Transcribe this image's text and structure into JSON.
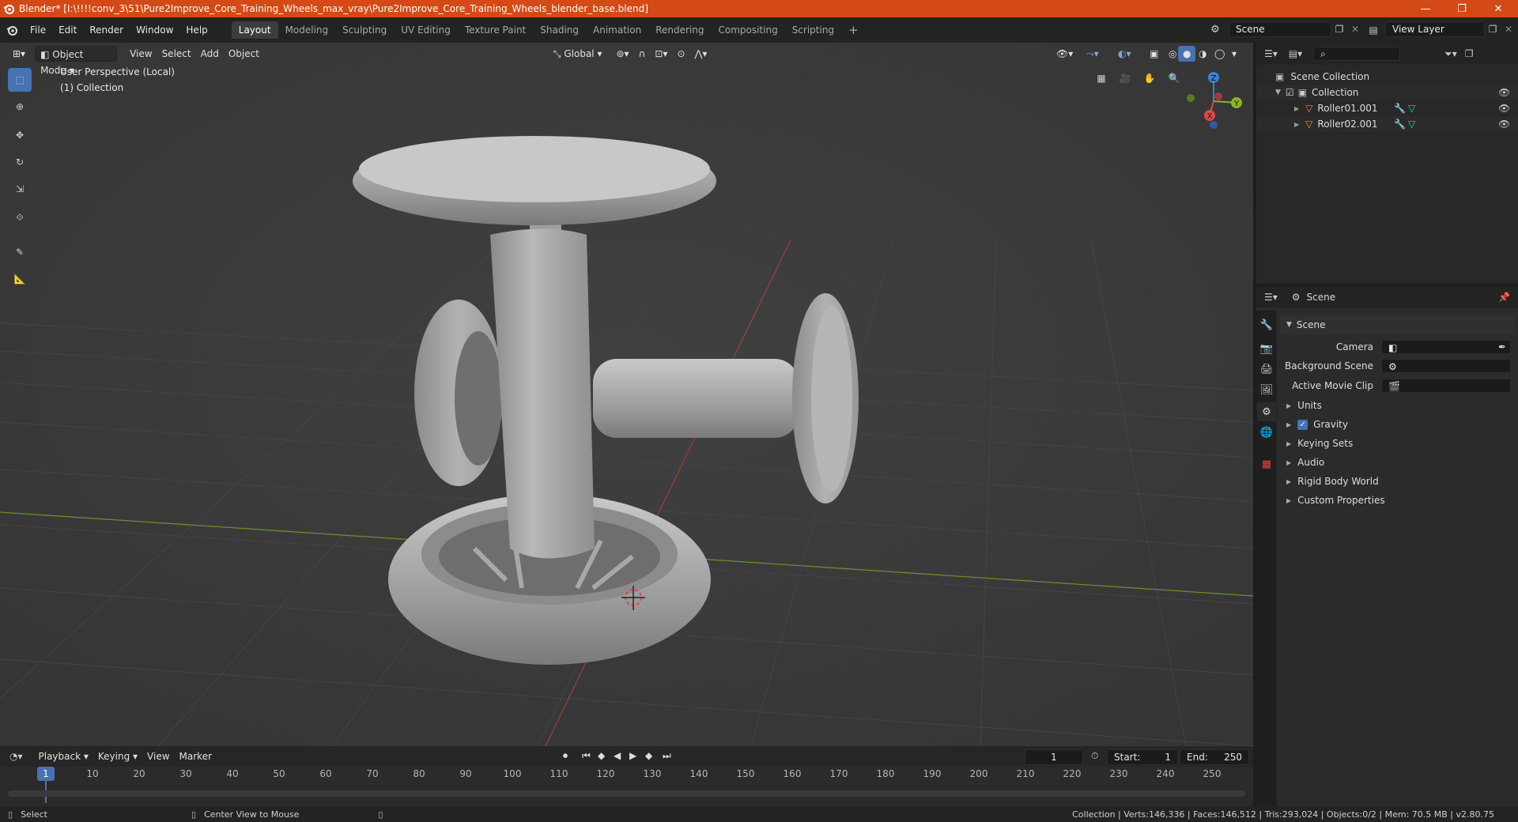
{
  "window": {
    "title": "Blender* [I:\\!!!!conv_3\\51\\Pure2Improve_Core_Training_Wheels_max_vray\\Pure2Improve_Core_Training_Wheels_blender_base.blend]",
    "minimize": "—",
    "maximize": "❐",
    "close": "✕"
  },
  "menu": [
    "File",
    "Edit",
    "Render",
    "Window",
    "Help"
  ],
  "workspaces": [
    "Layout",
    "Modeling",
    "Sculpting",
    "UV Editing",
    "Texture Paint",
    "Shading",
    "Animation",
    "Rendering",
    "Compositing",
    "Scripting"
  ],
  "active_workspace": "Layout",
  "scene_field": "Scene",
  "view_layer_field": "View Layer",
  "viewport": {
    "mode": "Object Mode",
    "menus": [
      "View",
      "Select",
      "Add",
      "Object"
    ],
    "orientation": "Global",
    "info_line1": "User Perspective (Local)",
    "info_line2": "(1) Collection",
    "gizmo": {
      "z": "Z",
      "y": "Y",
      "x": "X"
    }
  },
  "outliner": {
    "root": "Scene Collection",
    "collection": "Collection",
    "items": [
      "Roller01.001",
      "Roller02.001"
    ]
  },
  "properties": {
    "header": "Scene",
    "panel": "Scene",
    "fields": [
      {
        "label": "Camera",
        "value": ""
      },
      {
        "label": "Background Scene",
        "value": ""
      },
      {
        "label": "Active Movie Clip",
        "value": ""
      }
    ],
    "subpanels": [
      "Units",
      "Gravity",
      "Keying Sets",
      "Audio",
      "Rigid Body World",
      "Custom Properties"
    ],
    "gravity_checked": true
  },
  "timeline": {
    "menus": [
      "Playback",
      "Keying",
      "View",
      "Marker"
    ],
    "current_frame": "1",
    "start_label": "Start:",
    "start": "1",
    "end_label": "End:",
    "end": "250",
    "ticks": [
      "1",
      "10",
      "20",
      "30",
      "40",
      "50",
      "60",
      "70",
      "80",
      "90",
      "100",
      "110",
      "120",
      "130",
      "140",
      "150",
      "160",
      "170",
      "180",
      "190",
      "200",
      "210",
      "220",
      "230",
      "240",
      "250"
    ]
  },
  "statusbar": {
    "left": "Select",
    "middle": "Center View to Mouse",
    "right": "Collection | Verts:146,336 | Faces:146,512 | Tris:293,024 | Objects:0/2 | Mem: 70.5 MB | v2.80.75"
  },
  "colors": {
    "accent": "#4772b3",
    "titlebar": "#d44a16",
    "viewport": "#393939"
  }
}
